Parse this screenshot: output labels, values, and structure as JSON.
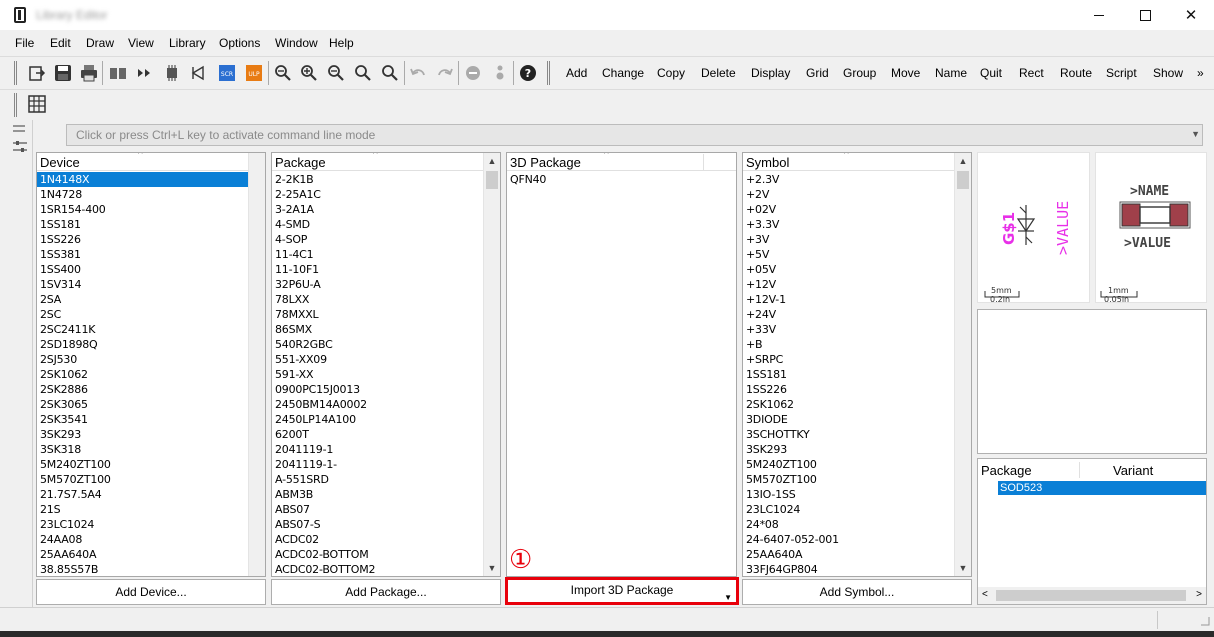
{
  "window": {
    "title": "Library Editor",
    "close_glyph": "✕"
  },
  "menu": [
    "File",
    "Edit",
    "Draw",
    "View",
    "Library",
    "Options",
    "Window",
    "Help"
  ],
  "toolbar": {
    "commands": [
      "Add",
      "Change",
      "Copy",
      "Delete",
      "Display",
      "Grid",
      "Group",
      "Move",
      "Name",
      "Quit",
      "Rect",
      "Route",
      "Script",
      "Show"
    ],
    "overflow_glyph": "»"
  },
  "command_line": {
    "placeholder": "Click or press Ctrl+L key to activate command line mode"
  },
  "device_column": {
    "header": "Device",
    "items": [
      "1N4148X",
      "1N4728",
      "1SR154-400",
      "1SS181",
      "1SS226",
      "1SS381",
      "1SS400",
      "1SV314",
      "2SA",
      "2SC",
      "2SC2411K",
      "2SD1898Q",
      "2SJ530",
      "2SK1062",
      "2SK2886",
      "2SK3065",
      "2SK3541",
      "3SK293",
      "3SK318",
      "5M240ZT100",
      "5M570ZT100",
      "21.7S7.5A4",
      "21S",
      "23LC1024",
      "24AA08",
      "25AA640A",
      "38.85S57B"
    ],
    "selected": "1N4148X",
    "button": "Add Device..."
  },
  "package_column": {
    "header": "Package",
    "items": [
      "2-2K1B",
      "2-25A1C",
      "3-2A1A",
      "4-SMD",
      "4-SOP",
      "11-4C1",
      "11-10F1",
      "32P6U-A",
      "78LXX",
      "78MXXL",
      "86SMX",
      "540R2GBC",
      "551-XX09",
      "591-XX",
      "0900PC15J0013",
      "2450BM14A0002",
      "2450LP14A100",
      "6200T",
      "2041119-1",
      "2041119-1-",
      "A-551SRD",
      "ABM3B",
      "ABS07",
      "ABS07-S",
      "ACDC02",
      "ACDC02-BOTTOM",
      "ACDC02-BOTTOM2"
    ],
    "button": "Add Package..."
  },
  "package3d_column": {
    "header": "3D Package",
    "items": [
      "QFN40"
    ],
    "button": "Import 3D Package"
  },
  "symbol_column": {
    "header": "Symbol",
    "items": [
      "+2.3V",
      "+2V",
      "+02V",
      "+3.3V",
      "+3V",
      "+5V",
      "+05V",
      "+12V",
      "+12V-1",
      "+24V",
      "+33V",
      "+B",
      "+SRPC",
      "1SS181",
      "1SS226",
      "2SK1062",
      "3DIODE",
      "3SCHOTTKY",
      "3SK293",
      "5M240ZT100",
      "5M570ZT100",
      "13IO-1SS",
      "23LC1024",
      "24*08",
      "24-6407-052-001",
      "25AA640A",
      "33FJ64GP804"
    ],
    "button": "Add Symbol..."
  },
  "symbol_preview": {
    "name_label": "G$1",
    "value_label": ">VALUE",
    "scale_top": "5mm",
    "scale_bottom": "0.2in"
  },
  "package_preview": {
    "name_label": ">NAME",
    "value_label": ">VALUE",
    "scale_top": "1mm",
    "scale_bottom": "0.05in"
  },
  "variant_table": {
    "col_package": "Package",
    "col_variant": "Variant",
    "selected": "SOD523"
  },
  "annotation": "①",
  "colors": {
    "selection": "#0a7fd6",
    "highlight_border": "#e8000b",
    "symbol_magenta": "#e830e8",
    "pad_red": "#a0404a"
  }
}
